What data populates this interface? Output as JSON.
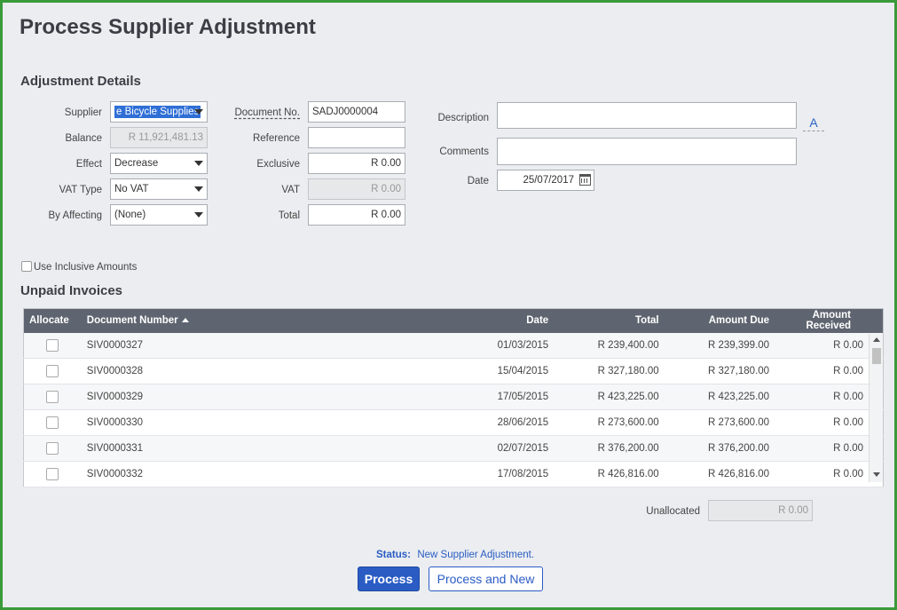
{
  "page": {
    "title": "Process Supplier Adjustment"
  },
  "details": {
    "heading": "Adjustment Details",
    "supplier_label": "Supplier",
    "supplier_value": "e Bicycle Supplies",
    "balance_label": "Balance",
    "balance_value": "R 11,921,481.13",
    "effect_label": "Effect",
    "effect_value": "Decrease",
    "vat_type_label": "VAT Type",
    "vat_type_value": "No VAT",
    "by_affecting_label": "By Affecting",
    "by_affecting_value": "(None)",
    "document_no_label": "Document No.",
    "document_no_value": "SADJ0000004",
    "reference_label": "Reference",
    "reference_value": "",
    "exclusive_label": "Exclusive",
    "exclusive_value": "R 0.00",
    "vat_label": "VAT",
    "vat_value": "R 0.00",
    "total_label": "Total",
    "total_value": "R 0.00",
    "description_label": "Description",
    "description_value": "",
    "comments_label": "Comments",
    "comments_value": "",
    "date_label": "Date",
    "date_value": "25/07/2017",
    "text_format_icon": "A"
  },
  "inclusive": {
    "label": "Use Inclusive Amounts",
    "checked": false
  },
  "invoices": {
    "heading": "Unpaid Invoices",
    "columns": [
      "Allocate",
      "Document Number",
      "Date",
      "Total",
      "Amount Due",
      "Amount Received"
    ],
    "rows": [
      {
        "doc": "SIV0000327",
        "date": "01/03/2015",
        "total": "R 239,400.00",
        "due": "R 239,399.00",
        "received": "R 0.00"
      },
      {
        "doc": "SIV0000328",
        "date": "15/04/2015",
        "total": "R 327,180.00",
        "due": "R 327,180.00",
        "received": "R 0.00"
      },
      {
        "doc": "SIV0000329",
        "date": "17/05/2015",
        "total": "R 423,225.00",
        "due": "R 423,225.00",
        "received": "R 0.00"
      },
      {
        "doc": "SIV0000330",
        "date": "28/06/2015",
        "total": "R 273,600.00",
        "due": "R 273,600.00",
        "received": "R 0.00"
      },
      {
        "doc": "SIV0000331",
        "date": "02/07/2015",
        "total": "R 376,200.00",
        "due": "R 376,200.00",
        "received": "R 0.00"
      },
      {
        "doc": "SIV0000332",
        "date": "17/08/2015",
        "total": "R 426,816.00",
        "due": "R 426,816.00",
        "received": "R 0.00"
      }
    ]
  },
  "unallocated": {
    "label": "Unallocated",
    "value": "R 0.00"
  },
  "status": {
    "label": "Status:",
    "value": "New Supplier Adjustment."
  },
  "actions": {
    "process": "Process",
    "process_new": "Process and New"
  },
  "colors": {
    "border": "#3a9a3a",
    "primary": "#2a5cc4",
    "header": "#5f6570"
  }
}
